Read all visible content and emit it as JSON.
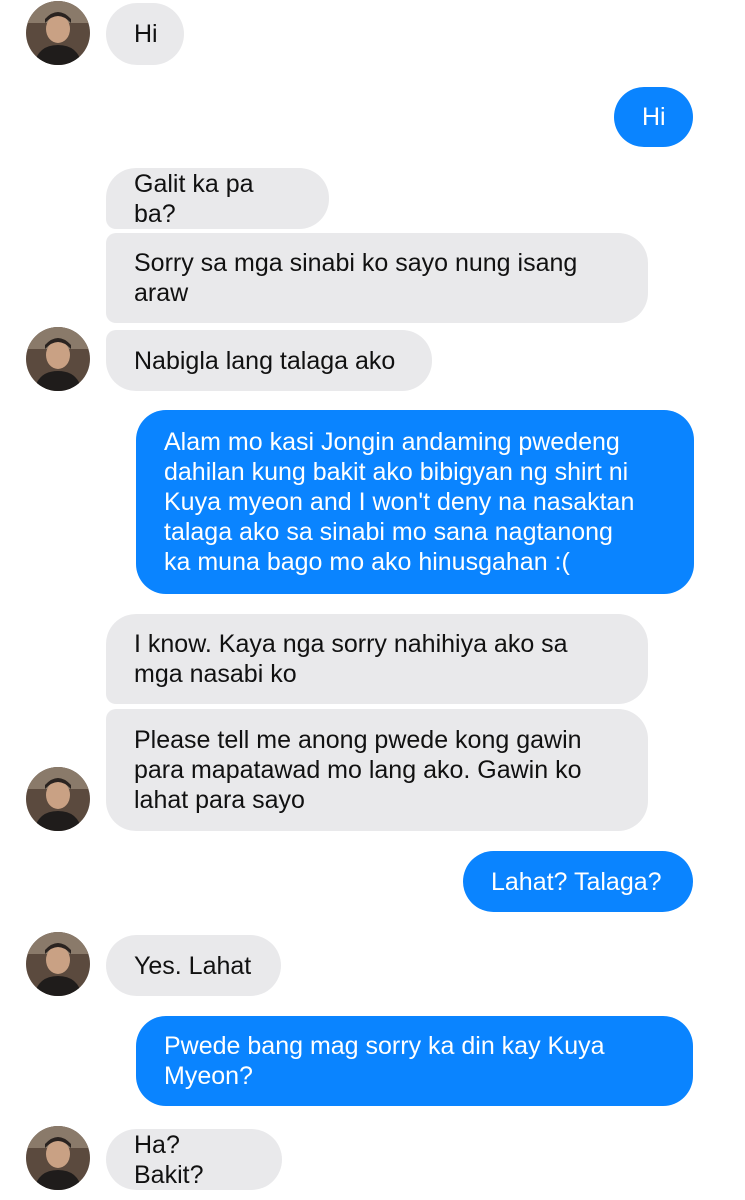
{
  "colors": {
    "incoming_bubble": "#e9e9eb",
    "outgoing_bubble": "#0a84ff",
    "incoming_text": "#111111",
    "outgoing_text": "#ffffff"
  },
  "contact": {
    "avatar_icon": "profile-photo"
  },
  "messages": [
    {
      "from": "contact",
      "text": "Hi"
    },
    {
      "from": "me",
      "text": "Hi"
    },
    {
      "from": "contact",
      "text": "Galit ka pa ba?"
    },
    {
      "from": "contact",
      "text": "Sorry sa mga sinabi ko sayo nung isang\naraw"
    },
    {
      "from": "contact",
      "text": "Nabigla lang talaga ako"
    },
    {
      "from": "me",
      "text": "Alam mo kasi Jongin andaming pwedeng\ndahilan kung bakit ako bibigyan ng shirt ni\nKuya myeon and I won't deny na nasaktan\ntalaga ako sa sinabi mo sana nagtanong\nka muna bago mo ako hinusgahan :("
    },
    {
      "from": "contact",
      "text": "I know. Kaya nga sorry nahihiya ako sa\nmga nasabi ko"
    },
    {
      "from": "contact",
      "text": "Please tell me anong pwede kong gawin\npara mapatawad mo lang ako. Gawin ko\nlahat para sayo"
    },
    {
      "from": "me",
      "text": "Lahat? Talaga?"
    },
    {
      "from": "contact",
      "text": "Yes. Lahat"
    },
    {
      "from": "me",
      "text": "Pwede bang mag sorry ka din kay Kuya\nMyeon?"
    },
    {
      "from": "contact",
      "text": "Ha? Bakit?"
    }
  ]
}
